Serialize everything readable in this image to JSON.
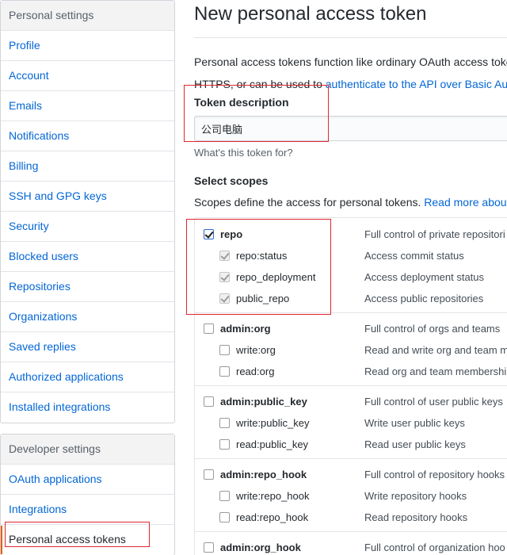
{
  "sidebar": {
    "personal_heading": "Personal settings",
    "personal_items": [
      {
        "label": "Profile"
      },
      {
        "label": "Account"
      },
      {
        "label": "Emails"
      },
      {
        "label": "Notifications"
      },
      {
        "label": "Billing"
      },
      {
        "label": "SSH and GPG keys"
      },
      {
        "label": "Security"
      },
      {
        "label": "Blocked users"
      },
      {
        "label": "Repositories"
      },
      {
        "label": "Organizations"
      },
      {
        "label": "Saved replies"
      },
      {
        "label": "Authorized applications"
      },
      {
        "label": "Installed integrations"
      }
    ],
    "developer_heading": "Developer settings",
    "developer_items": [
      {
        "label": "OAuth applications"
      },
      {
        "label": "Integrations"
      },
      {
        "label": "Personal access tokens"
      }
    ],
    "active_item_color": "#e36209"
  },
  "main": {
    "title": "New personal access token",
    "intro_line1": "Personal access tokens function like ordinary OAuth access toker",
    "intro_line2_prefix": "HTTPS, or can be used to ",
    "intro_link": "authenticate to the API over Basic Auth",
    "token_description_label": "Token description",
    "token_description_value": "公司电脑",
    "token_note": "What's this token for?",
    "select_scopes_label": "Select scopes",
    "scopes_desc_prefix": "Scopes define the access for personal tokens. ",
    "scopes_desc_link": "Read more about O",
    "scopes": [
      {
        "name": "repo",
        "desc": "Full control of private repositori",
        "checked": true,
        "children": [
          {
            "name": "repo:status",
            "desc": "Access commit status",
            "checked": true
          },
          {
            "name": "repo_deployment",
            "desc": "Access deployment status",
            "checked": true
          },
          {
            "name": "public_repo",
            "desc": "Access public repositories",
            "checked": true
          }
        ]
      },
      {
        "name": "admin:org",
        "desc": "Full control of orgs and teams",
        "checked": false,
        "children": [
          {
            "name": "write:org",
            "desc": "Read and write org and team m",
            "checked": false
          },
          {
            "name": "read:org",
            "desc": "Read org and team membership",
            "checked": false
          }
        ]
      },
      {
        "name": "admin:public_key",
        "desc": "Full control of user public keys",
        "checked": false,
        "children": [
          {
            "name": "write:public_key",
            "desc": "Write user public keys",
            "checked": false
          },
          {
            "name": "read:public_key",
            "desc": "Read user public keys",
            "checked": false
          }
        ]
      },
      {
        "name": "admin:repo_hook",
        "desc": "Full control of repository hooks",
        "checked": false,
        "children": [
          {
            "name": "write:repo_hook",
            "desc": "Write repository hooks",
            "checked": false
          },
          {
            "name": "read:repo_hook",
            "desc": "Read repository hooks",
            "checked": false
          }
        ]
      },
      {
        "name": "admin:org_hook",
        "desc": "Full control of organization hoo",
        "checked": false,
        "children": []
      }
    ]
  },
  "colors": {
    "link": "#0366d6",
    "annotation": "#e0262f"
  }
}
